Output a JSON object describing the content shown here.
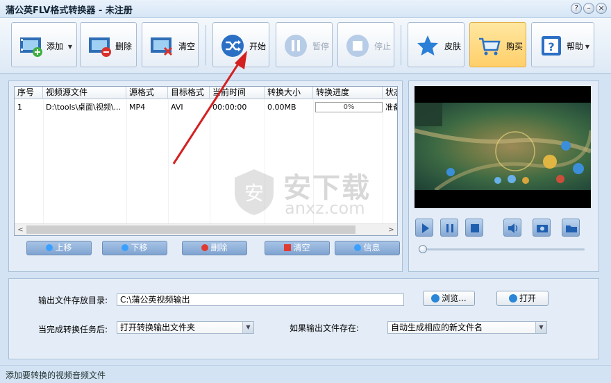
{
  "window": {
    "title": "蒲公英FLV格式转换器 - 未注册",
    "help_btn": "?",
    "min_btn": "–",
    "close_btn": "×"
  },
  "toolbar": {
    "add": "添加",
    "delete": "删除",
    "clear": "清空",
    "start": "开始",
    "pause": "暂停",
    "stop": "停止",
    "skin": "皮肤",
    "buy": "购买",
    "help": "帮助",
    "dropdown": "▼"
  },
  "table": {
    "columns": [
      "序号",
      "视频源文件",
      "源格式",
      "目标格式",
      "当前时间",
      "转换大小",
      "转换进度",
      "状态"
    ],
    "rows": [
      {
        "index": "1",
        "source": "D:\\tools\\桌面\\视频\\...",
        "src_format": "MP4",
        "dst_format": "AVI",
        "time": "00:00:00",
        "size": "0.00MB",
        "progress": "0%",
        "status": "准备"
      }
    ],
    "scroll_left": "<",
    "scroll_right": ">"
  },
  "list_buttons": {
    "up": "上移",
    "down": "下移",
    "delete": "删除",
    "clear": "清空",
    "info": "信息"
  },
  "output": {
    "dir_label": "输出文件存放目录:",
    "dir_value": "C:\\蒲公英视频输出",
    "browse": "浏览...",
    "open": "打开",
    "after_label": "当完成转换任务后:",
    "after_value": "打开转换输出文件夹",
    "exists_label": "如果输出文件存在:",
    "exists_value": "自动生成相应的新文件名"
  },
  "status_text": "添加要转换的视频音频文件",
  "watermark": {
    "main": "安下载",
    "sub": "anxz.com",
    "badge": "安"
  },
  "player": {
    "position": 0.0
  },
  "colors": {
    "accent": "#2a6fc4",
    "buy_highlight": "#ffcf6a",
    "arrow": "#d42020"
  }
}
